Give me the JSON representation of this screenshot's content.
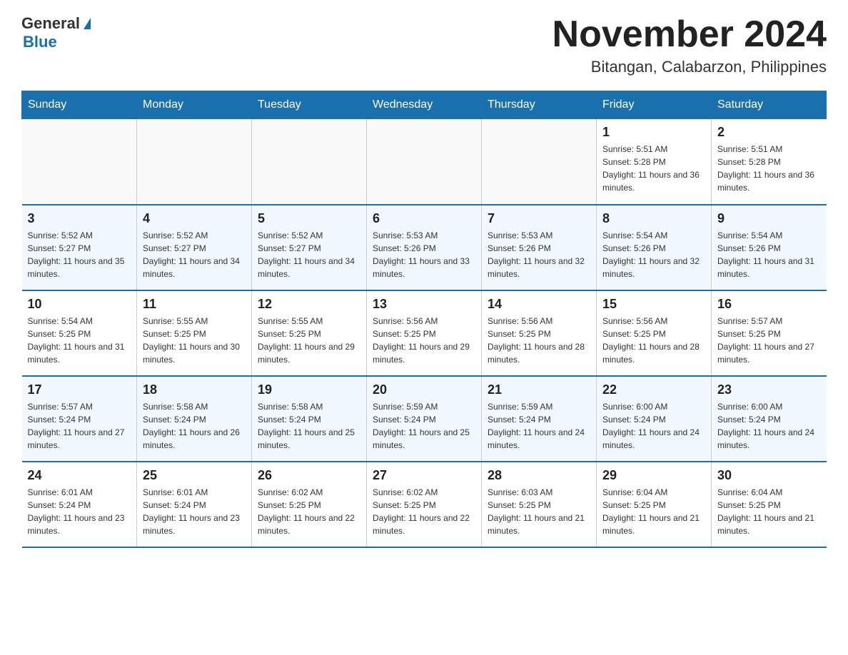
{
  "header": {
    "logo_general": "General",
    "logo_blue": "Blue",
    "month_title": "November 2024",
    "location": "Bitangan, Calabarzon, Philippines"
  },
  "days_of_week": [
    "Sunday",
    "Monday",
    "Tuesday",
    "Wednesday",
    "Thursday",
    "Friday",
    "Saturday"
  ],
  "weeks": [
    [
      {
        "day": "",
        "sunrise": "",
        "sunset": "",
        "daylight": ""
      },
      {
        "day": "",
        "sunrise": "",
        "sunset": "",
        "daylight": ""
      },
      {
        "day": "",
        "sunrise": "",
        "sunset": "",
        "daylight": ""
      },
      {
        "day": "",
        "sunrise": "",
        "sunset": "",
        "daylight": ""
      },
      {
        "day": "",
        "sunrise": "",
        "sunset": "",
        "daylight": ""
      },
      {
        "day": "1",
        "sunrise": "Sunrise: 5:51 AM",
        "sunset": "Sunset: 5:28 PM",
        "daylight": "Daylight: 11 hours and 36 minutes."
      },
      {
        "day": "2",
        "sunrise": "Sunrise: 5:51 AM",
        "sunset": "Sunset: 5:28 PM",
        "daylight": "Daylight: 11 hours and 36 minutes."
      }
    ],
    [
      {
        "day": "3",
        "sunrise": "Sunrise: 5:52 AM",
        "sunset": "Sunset: 5:27 PM",
        "daylight": "Daylight: 11 hours and 35 minutes."
      },
      {
        "day": "4",
        "sunrise": "Sunrise: 5:52 AM",
        "sunset": "Sunset: 5:27 PM",
        "daylight": "Daylight: 11 hours and 34 minutes."
      },
      {
        "day": "5",
        "sunrise": "Sunrise: 5:52 AM",
        "sunset": "Sunset: 5:27 PM",
        "daylight": "Daylight: 11 hours and 34 minutes."
      },
      {
        "day": "6",
        "sunrise": "Sunrise: 5:53 AM",
        "sunset": "Sunset: 5:26 PM",
        "daylight": "Daylight: 11 hours and 33 minutes."
      },
      {
        "day": "7",
        "sunrise": "Sunrise: 5:53 AM",
        "sunset": "Sunset: 5:26 PM",
        "daylight": "Daylight: 11 hours and 32 minutes."
      },
      {
        "day": "8",
        "sunrise": "Sunrise: 5:54 AM",
        "sunset": "Sunset: 5:26 PM",
        "daylight": "Daylight: 11 hours and 32 minutes."
      },
      {
        "day": "9",
        "sunrise": "Sunrise: 5:54 AM",
        "sunset": "Sunset: 5:26 PM",
        "daylight": "Daylight: 11 hours and 31 minutes."
      }
    ],
    [
      {
        "day": "10",
        "sunrise": "Sunrise: 5:54 AM",
        "sunset": "Sunset: 5:25 PM",
        "daylight": "Daylight: 11 hours and 31 minutes."
      },
      {
        "day": "11",
        "sunrise": "Sunrise: 5:55 AM",
        "sunset": "Sunset: 5:25 PM",
        "daylight": "Daylight: 11 hours and 30 minutes."
      },
      {
        "day": "12",
        "sunrise": "Sunrise: 5:55 AM",
        "sunset": "Sunset: 5:25 PM",
        "daylight": "Daylight: 11 hours and 29 minutes."
      },
      {
        "day": "13",
        "sunrise": "Sunrise: 5:56 AM",
        "sunset": "Sunset: 5:25 PM",
        "daylight": "Daylight: 11 hours and 29 minutes."
      },
      {
        "day": "14",
        "sunrise": "Sunrise: 5:56 AM",
        "sunset": "Sunset: 5:25 PM",
        "daylight": "Daylight: 11 hours and 28 minutes."
      },
      {
        "day": "15",
        "sunrise": "Sunrise: 5:56 AM",
        "sunset": "Sunset: 5:25 PM",
        "daylight": "Daylight: 11 hours and 28 minutes."
      },
      {
        "day": "16",
        "sunrise": "Sunrise: 5:57 AM",
        "sunset": "Sunset: 5:25 PM",
        "daylight": "Daylight: 11 hours and 27 minutes."
      }
    ],
    [
      {
        "day": "17",
        "sunrise": "Sunrise: 5:57 AM",
        "sunset": "Sunset: 5:24 PM",
        "daylight": "Daylight: 11 hours and 27 minutes."
      },
      {
        "day": "18",
        "sunrise": "Sunrise: 5:58 AM",
        "sunset": "Sunset: 5:24 PM",
        "daylight": "Daylight: 11 hours and 26 minutes."
      },
      {
        "day": "19",
        "sunrise": "Sunrise: 5:58 AM",
        "sunset": "Sunset: 5:24 PM",
        "daylight": "Daylight: 11 hours and 25 minutes."
      },
      {
        "day": "20",
        "sunrise": "Sunrise: 5:59 AM",
        "sunset": "Sunset: 5:24 PM",
        "daylight": "Daylight: 11 hours and 25 minutes."
      },
      {
        "day": "21",
        "sunrise": "Sunrise: 5:59 AM",
        "sunset": "Sunset: 5:24 PM",
        "daylight": "Daylight: 11 hours and 24 minutes."
      },
      {
        "day": "22",
        "sunrise": "Sunrise: 6:00 AM",
        "sunset": "Sunset: 5:24 PM",
        "daylight": "Daylight: 11 hours and 24 minutes."
      },
      {
        "day": "23",
        "sunrise": "Sunrise: 6:00 AM",
        "sunset": "Sunset: 5:24 PM",
        "daylight": "Daylight: 11 hours and 24 minutes."
      }
    ],
    [
      {
        "day": "24",
        "sunrise": "Sunrise: 6:01 AM",
        "sunset": "Sunset: 5:24 PM",
        "daylight": "Daylight: 11 hours and 23 minutes."
      },
      {
        "day": "25",
        "sunrise": "Sunrise: 6:01 AM",
        "sunset": "Sunset: 5:24 PM",
        "daylight": "Daylight: 11 hours and 23 minutes."
      },
      {
        "day": "26",
        "sunrise": "Sunrise: 6:02 AM",
        "sunset": "Sunset: 5:25 PM",
        "daylight": "Daylight: 11 hours and 22 minutes."
      },
      {
        "day": "27",
        "sunrise": "Sunrise: 6:02 AM",
        "sunset": "Sunset: 5:25 PM",
        "daylight": "Daylight: 11 hours and 22 minutes."
      },
      {
        "day": "28",
        "sunrise": "Sunrise: 6:03 AM",
        "sunset": "Sunset: 5:25 PM",
        "daylight": "Daylight: 11 hours and 21 minutes."
      },
      {
        "day": "29",
        "sunrise": "Sunrise: 6:04 AM",
        "sunset": "Sunset: 5:25 PM",
        "daylight": "Daylight: 11 hours and 21 minutes."
      },
      {
        "day": "30",
        "sunrise": "Sunrise: 6:04 AM",
        "sunset": "Sunset: 5:25 PM",
        "daylight": "Daylight: 11 hours and 21 minutes."
      }
    ]
  ]
}
